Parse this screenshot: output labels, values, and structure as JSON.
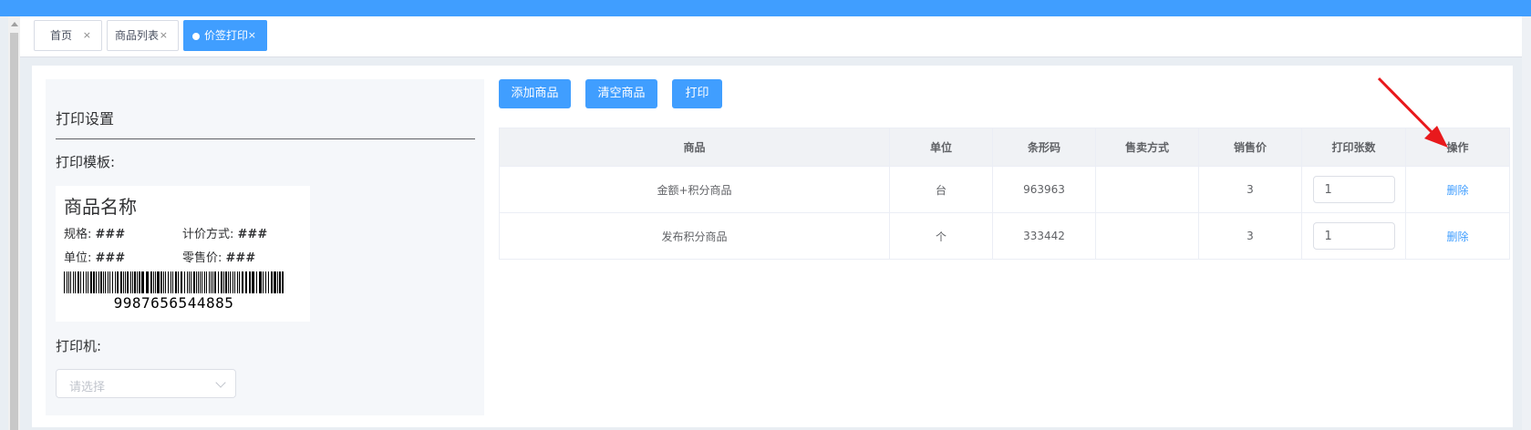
{
  "tabs": [
    {
      "label": "首页",
      "close": "×"
    },
    {
      "label": "商品列表",
      "close": "×"
    },
    {
      "label": "价签打印",
      "close": "×"
    }
  ],
  "settings": {
    "title": "打印设置",
    "template_label": "打印模板:",
    "printer_label": "打印机:",
    "printer_placeholder": "请选择"
  },
  "label_preview": {
    "name": "商品名称",
    "spec_label": "规格:",
    "spec_value": "###",
    "pricing_label": "计价方式:",
    "pricing_value": "###",
    "unit_label": "单位:",
    "unit_value": "###",
    "retail_label": "零售价:",
    "retail_value": "###",
    "barcode_number": "9987656544885"
  },
  "toolbar": {
    "add_label": "添加商品",
    "clear_label": "清空商品",
    "print_label": "打印"
  },
  "table": {
    "headers": [
      "商品",
      "单位",
      "条形码",
      "售卖方式",
      "销售价",
      "打印张数",
      "操作"
    ],
    "rows": [
      {
        "product": "金额+积分商品",
        "unit": "台",
        "barcode": "963963",
        "sale_mode": "",
        "price": "3",
        "copies": "1",
        "action": "删除"
      },
      {
        "product": "发布积分商品",
        "unit": "个",
        "barcode": "333442",
        "sale_mode": "",
        "price": "3",
        "copies": "1",
        "action": "删除"
      }
    ]
  },
  "colors": {
    "primary": "#409eff",
    "annotation_arrow": "#e8191c"
  }
}
